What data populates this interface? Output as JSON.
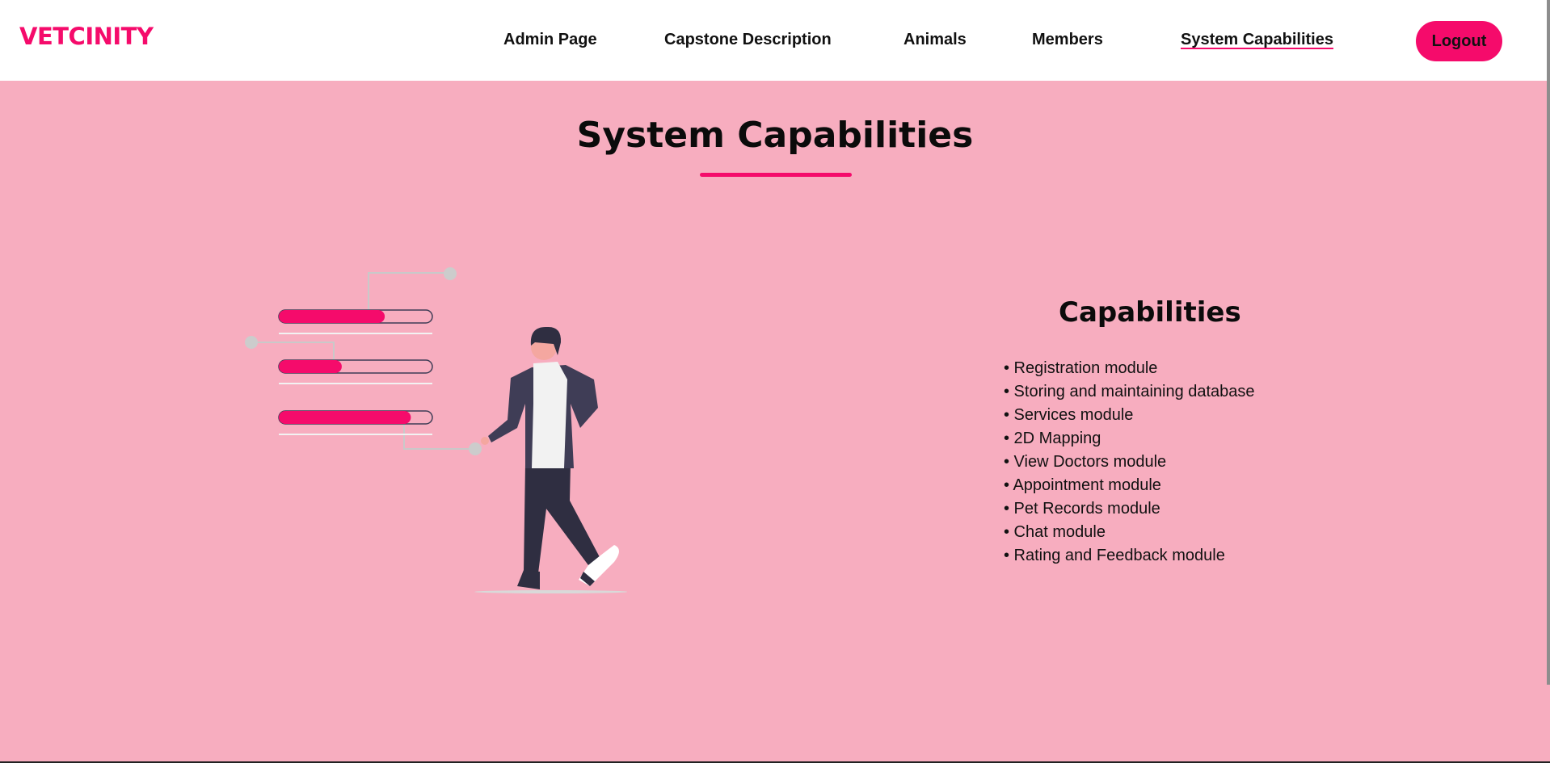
{
  "header": {
    "logo": "VETCINITY",
    "nav": [
      {
        "label": "Admin Page"
      },
      {
        "label": "Capstone Description"
      },
      {
        "label": "Animals"
      },
      {
        "label": "Members"
      },
      {
        "label": "System Capabilities",
        "active": true
      }
    ],
    "logout_label": "Logout"
  },
  "main": {
    "title": "System Capabilities",
    "capabilities_heading": "Capabilities",
    "capabilities": [
      "• Registration module",
      "• Storing and maintaining database",
      "• Services module",
      "• 2D Mapping",
      "• View Doctors module",
      "• Appointment module",
      "• Pet Records module",
      "• Chat module",
      "• Rating and Feedback module"
    ],
    "illustration": {
      "subject": "person-with-progress-bars",
      "progress_levels": [
        0.69,
        0.41,
        0.86
      ]
    }
  },
  "colors": {
    "accent": "#f50b6b",
    "background": "#f7adbf",
    "header_bg": "#ffffff",
    "text": "#111111"
  }
}
